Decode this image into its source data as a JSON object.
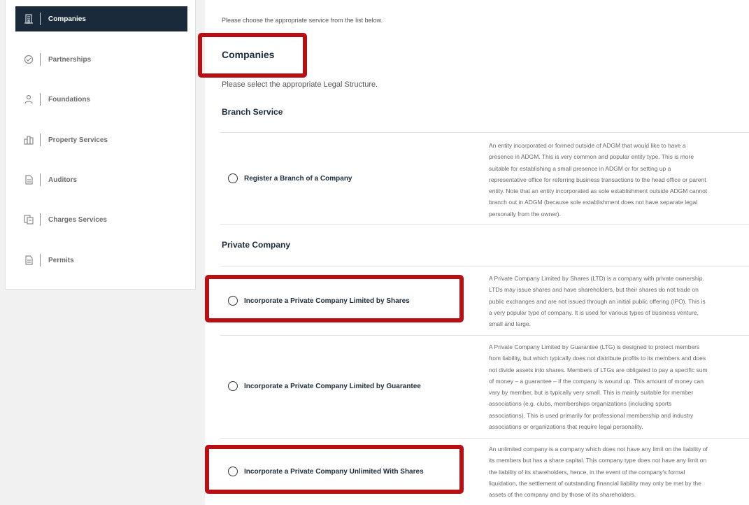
{
  "sidebar": {
    "items": [
      {
        "label": "Companies",
        "icon": "building-icon",
        "active": true
      },
      {
        "label": "Partnerships",
        "icon": "handshake-icon",
        "active": false
      },
      {
        "label": "Foundations",
        "icon": "people-icon",
        "active": false
      },
      {
        "label": "Property Services",
        "icon": "city-icon",
        "active": false
      },
      {
        "label": "Auditors",
        "icon": "document-icon",
        "active": false
      },
      {
        "label": "Charges Services",
        "icon": "documents-icon",
        "active": false
      },
      {
        "label": "Permits",
        "icon": "document-icon",
        "active": false
      }
    ]
  },
  "main": {
    "intro": "Please choose the appropriate service from the list below.",
    "title": "Companies",
    "subtitle": "Please select the appropriate Legal Structure.",
    "groups": [
      {
        "heading": "Branch Service",
        "options": [
          {
            "label": "Register a Branch of a Company",
            "description": [
              "An entity incorporated or formed outside of ADGM that would like to have a",
              "presence in ADGM. This is very common and popular entity type. This is more",
              "suitable for establishing a small presence in ADGM or for setting up a",
              "representative office for referring business transactions to the head office or parent",
              "entity. Note that an entity incorporated as sole establishment outside ADGM cannot",
              "branch out in ADGM (because sole establishment does not have separate legal",
              "personally from the owner)."
            ]
          }
        ]
      },
      {
        "heading": "Private Company",
        "options": [
          {
            "label": "Incorporate a Private Company Limited by Shares",
            "description": [
              "A Private Company Limited by Shares (LTD) is a company with private ownership.",
              "LTDs may issue shares and have shareholders, but their shares do not trade on",
              "public exchanges and are not issued through an initial public offering (IPO). This is",
              "a very popular type of company. It is used for various types of business venture,",
              "small and large."
            ]
          },
          {
            "label": "Incorporate a Private Company Limited by Guarantee",
            "description": [
              "A Private Company Limited by Guarantee (LTG) is designed to protect members",
              "from liability, but which typically does not distribute profits to its members and does",
              "not divide assets into shares. Members of LTGs are obligated to pay a specific sum",
              "of money – a guarantee – if the company is wound up. This amount of money can",
              "vary by member, but is typically very small. This is mainly suitable for member",
              "associations (e.g. clubs, memberships organizations (including sports",
              "associations). This is used primarily for professional membership and industry",
              "associations or organizations that require legal personality."
            ]
          },
          {
            "label": "Incorporate a Private Company Unlimited With Shares",
            "description": [
              "An unlimited company is a company which does not have any limit on the liability of",
              "its members but has a share capital. This company type does not have any limit on",
              "the liability of its shareholders, hence, in the event of the company's formal",
              "liquidation, the settlement of outstanding financial liability may only be met by the",
              "assets of the company and by those of its shareholders."
            ]
          }
        ]
      }
    ]
  },
  "colors": {
    "active_nav_bg": "#1a2a3a",
    "highlight": "#b80f14"
  }
}
